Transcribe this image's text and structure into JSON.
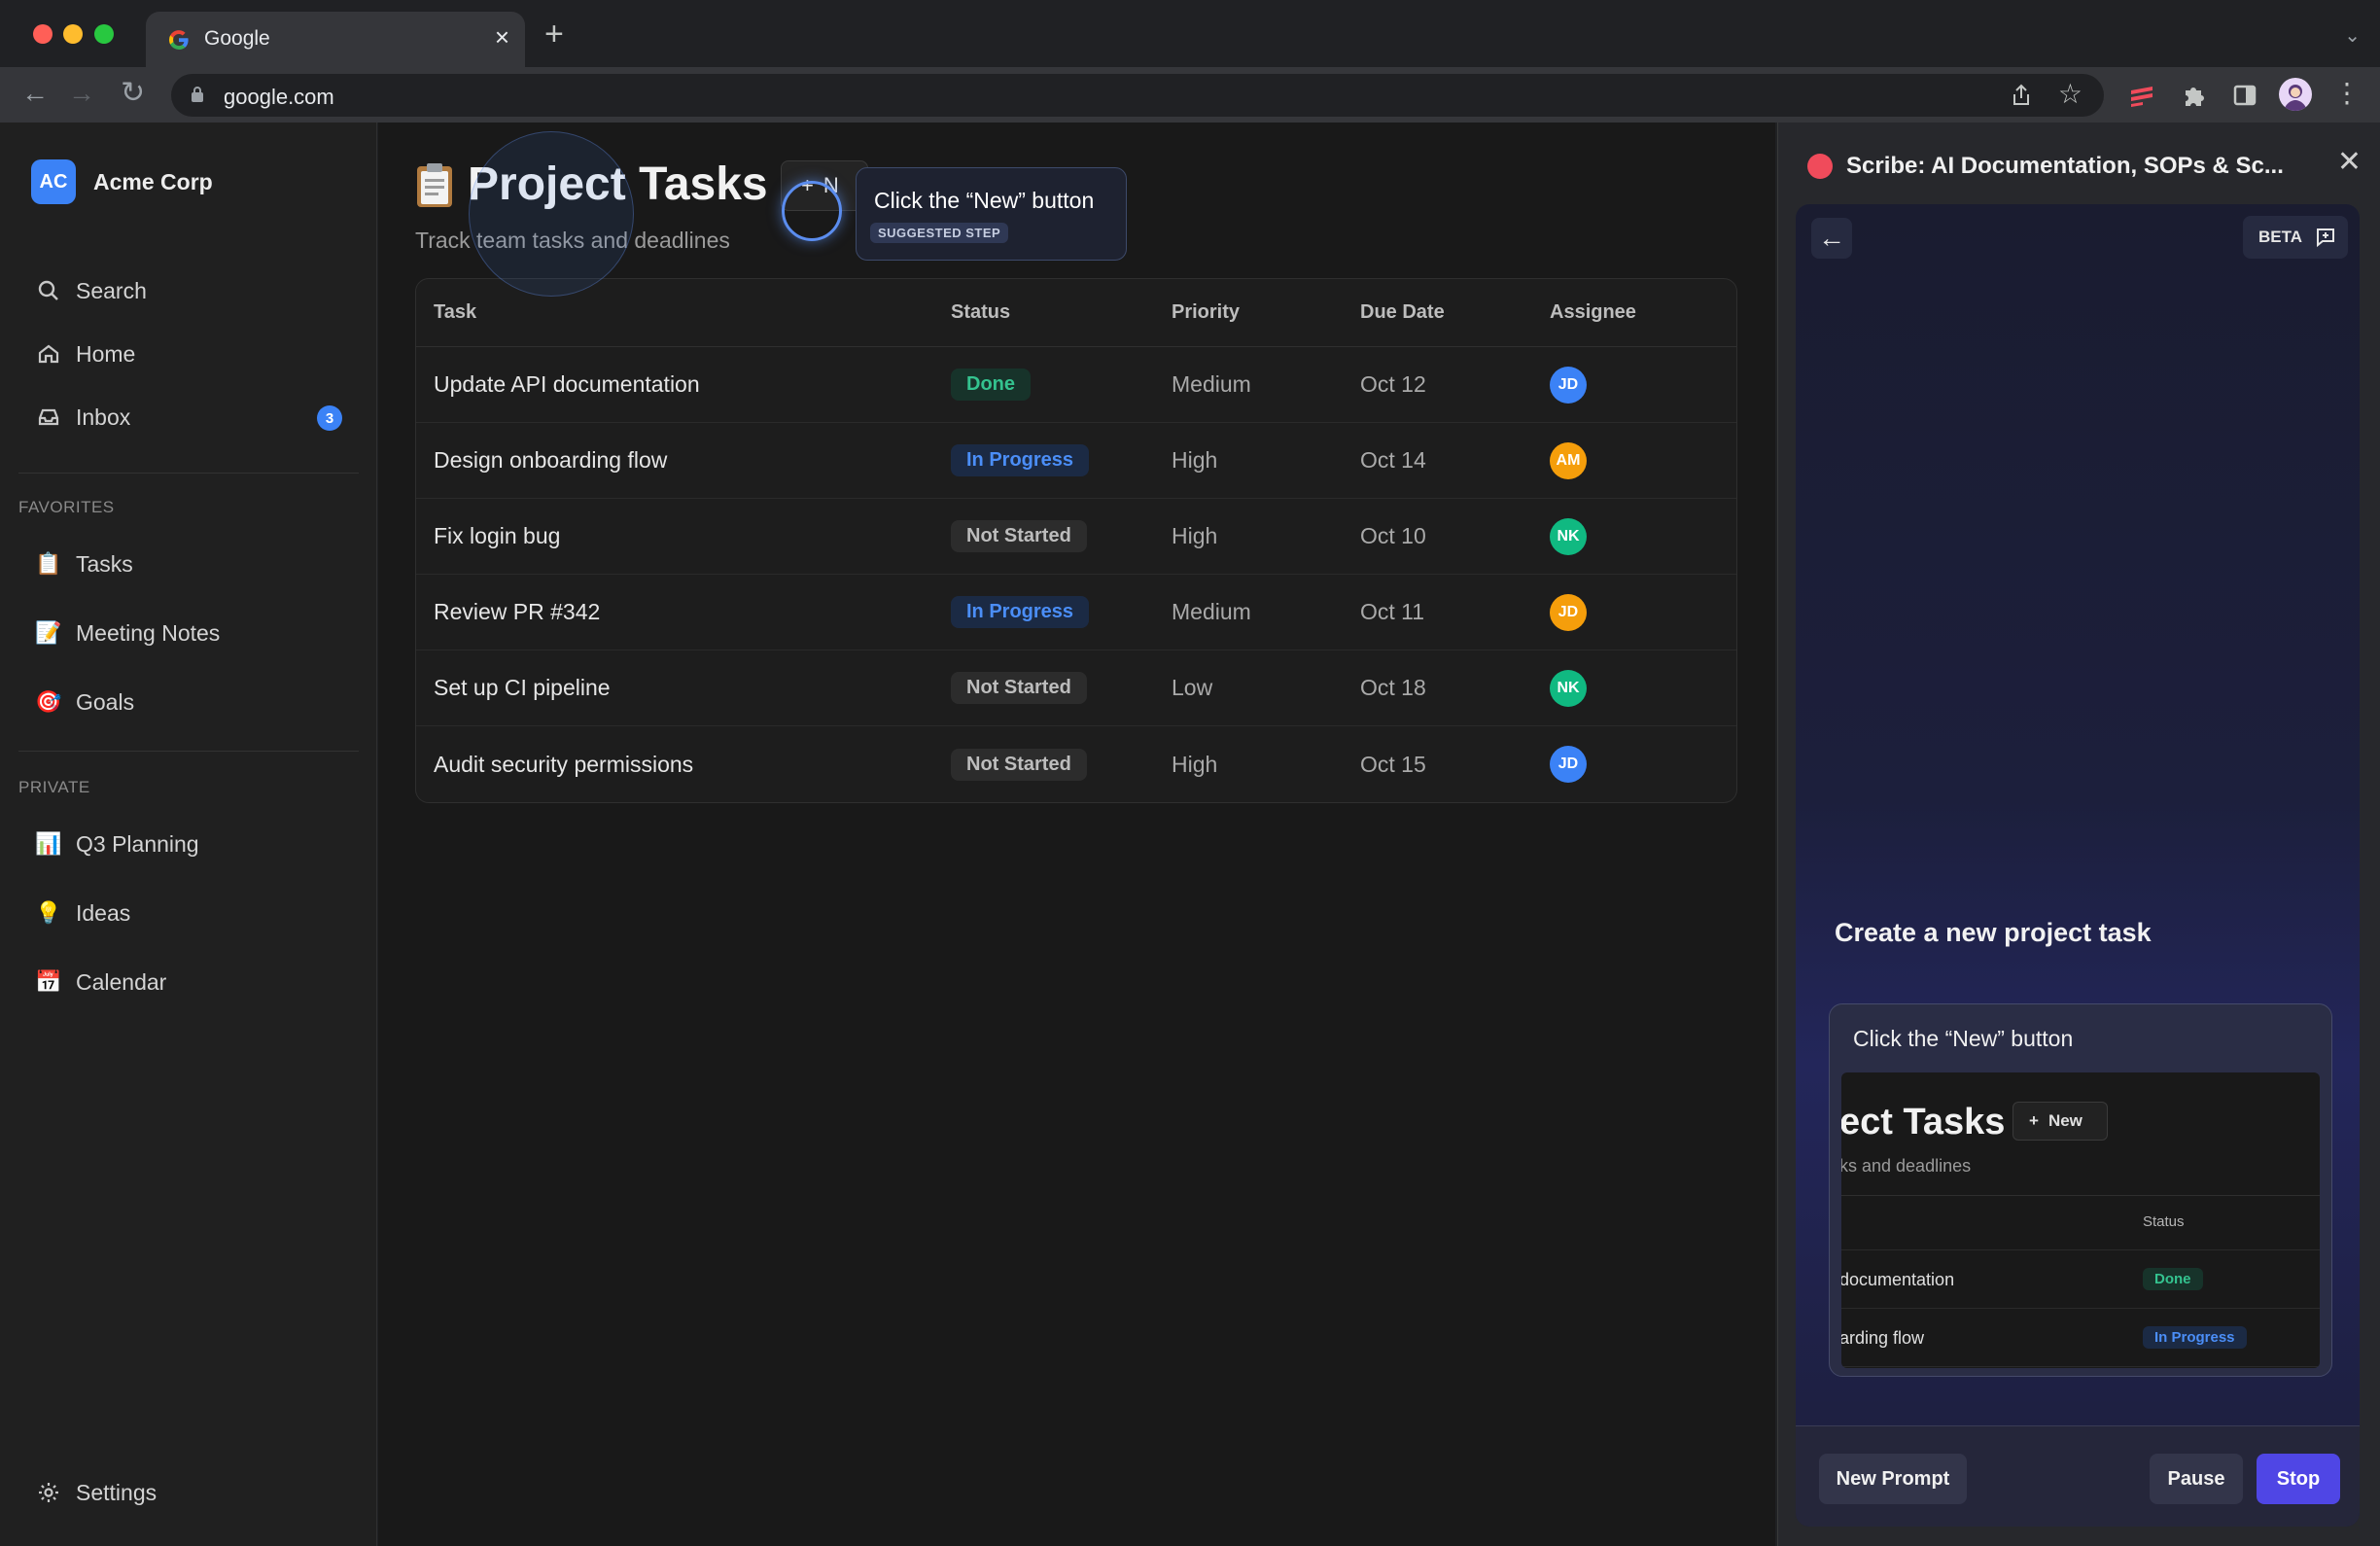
{
  "browser": {
    "tab_title": "Google",
    "url": "google.com"
  },
  "sidebar": {
    "workspace_initials": "AC",
    "workspace_name": "Acme Corp",
    "nav": [
      {
        "label": "Search",
        "icon": "search-icon"
      },
      {
        "label": "Home",
        "icon": "home-icon"
      },
      {
        "label": "Inbox",
        "icon": "inbox-icon",
        "badge": "3"
      }
    ],
    "favorites_label": "FAVORITES",
    "favorites": [
      {
        "label": "Tasks",
        "icon": "clipboard-icon",
        "glyph": "📋"
      },
      {
        "label": "Meeting Notes",
        "icon": "memo-icon",
        "glyph": "📝"
      },
      {
        "label": "Goals",
        "icon": "target-icon",
        "glyph": "🎯"
      }
    ],
    "private_label": "PRIVATE",
    "private": [
      {
        "label": "Q3 Planning",
        "icon": "bar-chart-icon",
        "glyph": "📊"
      },
      {
        "label": "Ideas",
        "icon": "lightbulb-icon",
        "glyph": "💡"
      },
      {
        "label": "Calendar",
        "icon": "calendar-icon",
        "glyph": "📅"
      }
    ],
    "settings_label": "Settings"
  },
  "main": {
    "title": "Project Tasks",
    "subtitle": "Track team tasks and deadlines",
    "new_button_label": "N",
    "columns": [
      "Task",
      "Status",
      "Priority",
      "Due Date",
      "Assignee"
    ],
    "rows": [
      {
        "task": "Update API documentation",
        "status": "Done",
        "priority": "Medium",
        "due": "Oct 12",
        "assignee": "JD"
      },
      {
        "task": "Design onboarding flow",
        "status": "In Progress",
        "priority": "High",
        "due": "Oct 14",
        "assignee": "AM"
      },
      {
        "task": "Fix login bug",
        "status": "Not Started",
        "priority": "High",
        "due": "Oct 10",
        "assignee": "NK"
      },
      {
        "task": "Review PR #342",
        "status": "In Progress",
        "priority": "Medium",
        "due": "Oct 11",
        "assignee": "JD"
      },
      {
        "task": "Set up CI pipeline",
        "status": "Not Started",
        "priority": "Low",
        "due": "Oct 18",
        "assignee": "NK"
      },
      {
        "task": "Audit security permissions",
        "status": "Not Started",
        "priority": "High",
        "due": "Oct 15",
        "assignee": "JD"
      }
    ],
    "status_colors": {
      "Done": "#34c38f",
      "In Progress": "#4b8ef7",
      "Not Started": "#bdbdbd"
    },
    "avatar_colors": [
      "#3b82f6",
      "#f59e0b",
      "#10b981",
      "#f59e0b",
      "#10b981",
      "#3b82f6"
    ]
  },
  "tooltip": {
    "text": "Click the “New” button",
    "tag": "SUGGESTED STEP"
  },
  "scribe": {
    "title": "Scribe: AI Documentation, SOPs & Sc...",
    "beta": "BETA",
    "heading": "Create a new project task",
    "step_title": "Click the “New” button",
    "preview": {
      "title": "ect Tasks",
      "new_label": "New",
      "subtitle": "ks and deadlines",
      "status_header": "Status",
      "rows": [
        {
          "task": "documentation",
          "status": "Done"
        },
        {
          "task": "arding flow",
          "status": "In Progress"
        }
      ]
    },
    "buttons": {
      "new_prompt": "New Prompt",
      "pause": "Pause",
      "stop": "Stop"
    },
    "accent": "#4f46e5"
  }
}
